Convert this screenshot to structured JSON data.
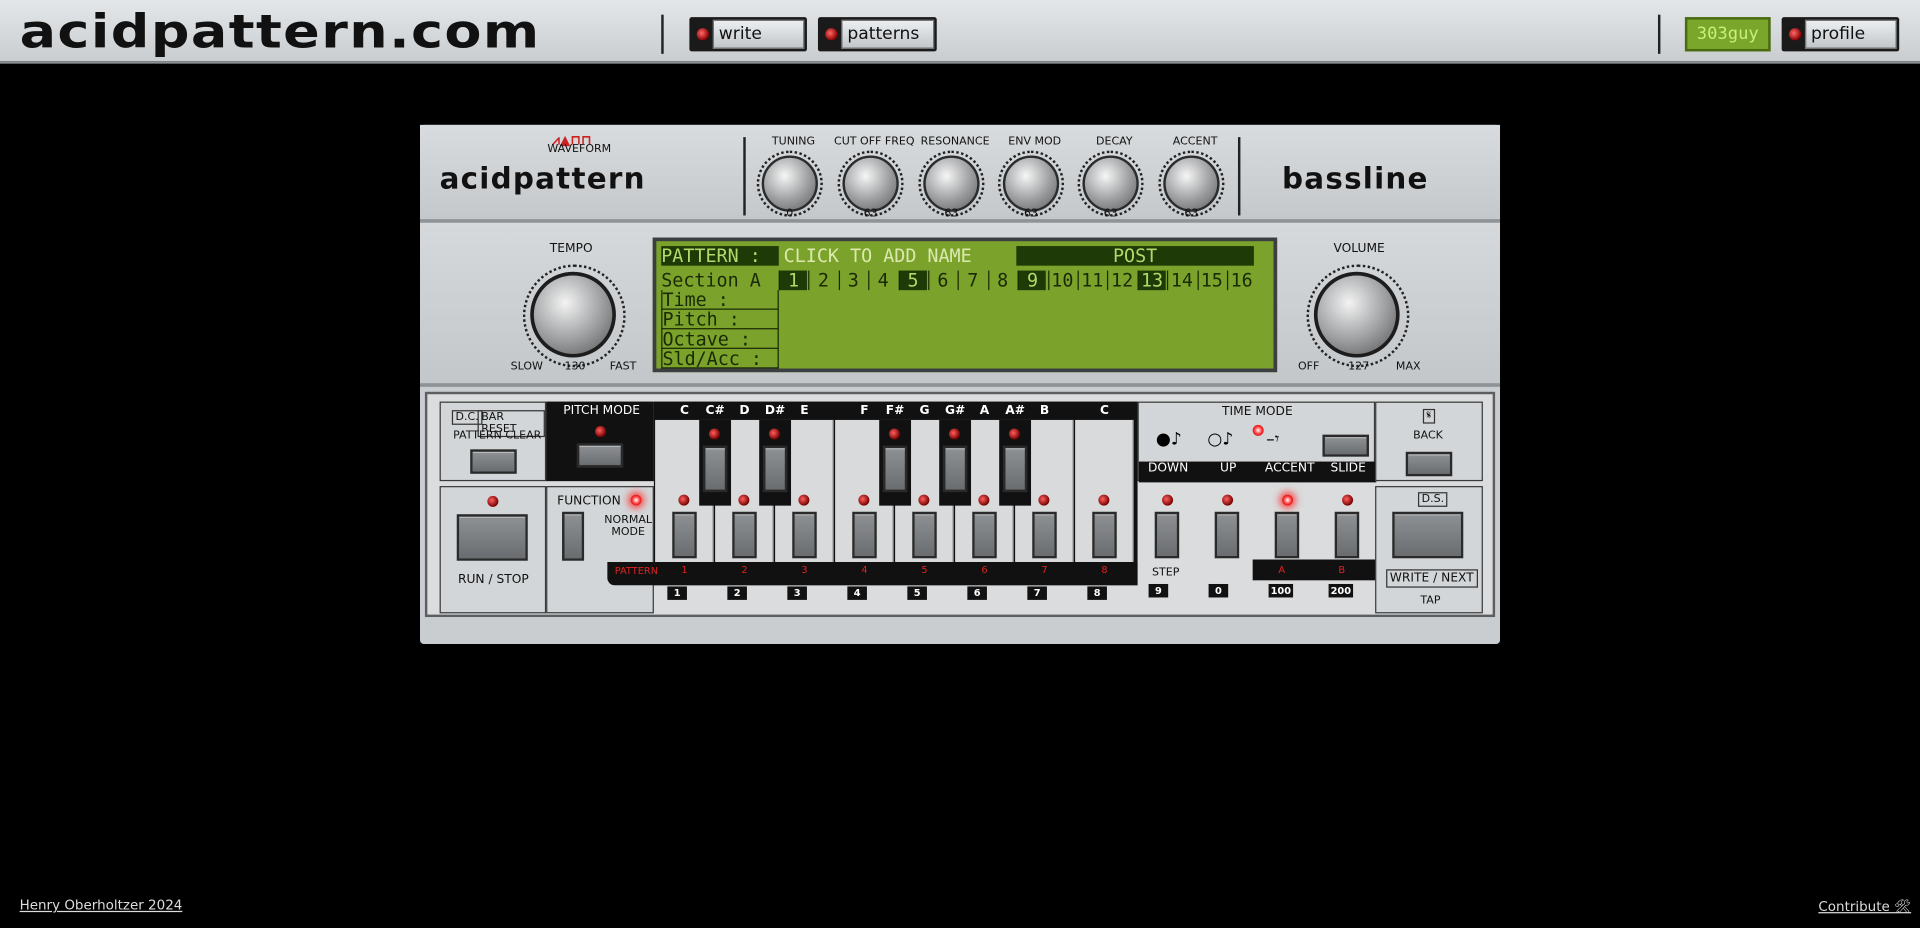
{
  "header": {
    "logo": "acidpattern.com",
    "nav": [
      {
        "label": "write"
      },
      {
        "label": "patterns"
      }
    ],
    "user": "303guy",
    "profile": "profile"
  },
  "synth": {
    "brand": "acidpattern",
    "model": "bassline",
    "waveform_label": "WAVEFORM",
    "knobs": [
      {
        "label": "TUNING",
        "value": "0"
      },
      {
        "label": "CUT OFF FREQ",
        "value": "63"
      },
      {
        "label": "RESONANCE",
        "value": "63"
      },
      {
        "label": "ENV MOD",
        "value": "63"
      },
      {
        "label": "DECAY",
        "value": "63"
      },
      {
        "label": "ACCENT",
        "value": "63"
      }
    ],
    "tempo": {
      "label": "TEMPO",
      "min": "SLOW",
      "value": "130",
      "max": "FAST"
    },
    "volume": {
      "label": "VOLUME",
      "min": "OFF",
      "value": "127",
      "max": "MAX"
    }
  },
  "lcd": {
    "pattern_label": "PATTERN :",
    "name_prompt": "CLICK TO ADD NAME",
    "post": "POST",
    "section_label": "Section A",
    "steps": [
      "1",
      "2",
      "3",
      "4",
      "5",
      "6",
      "7",
      "8",
      "9",
      "10",
      "11",
      "12",
      "13",
      "14",
      "15",
      "16"
    ],
    "rows": [
      "Time      :",
      "Pitch     :",
      "Octave    :",
      "Sld/Acc   :"
    ]
  },
  "controls": {
    "dc": "D.C.",
    "bar_reset": "BAR RESET",
    "pattern_clear": "PATTERN CLEAR",
    "pitch_mode": "PITCH MODE",
    "function": "FUNCTION",
    "normal_mode": "NORMAL MODE",
    "run_stop": "RUN / STOP",
    "pattern": "PATTERN",
    "time_mode": "TIME MODE",
    "back": "BACK",
    "ds": "D.S.",
    "write_next": "WRITE / NEXT",
    "tap": "TAP",
    "step": "STEP",
    "notes": [
      "C",
      "C#",
      "D",
      "D#",
      "E",
      "F",
      "F#",
      "G",
      "G#",
      "A",
      "A#",
      "B",
      "C"
    ],
    "pattern_numbers": [
      "1",
      "2",
      "3",
      "4",
      "5",
      "6",
      "7",
      "8"
    ],
    "bottom_numbers": [
      "1",
      "2",
      "3",
      "4",
      "5",
      "6",
      "7",
      "8",
      "9",
      "0",
      "100",
      "200"
    ],
    "mode_labels": [
      "DOWN",
      "UP",
      "ACCENT",
      "SLIDE"
    ],
    "ab": [
      "A",
      "B"
    ]
  },
  "footer": {
    "credit": "Henry Oberholtzer 2024",
    "contribute": "Contribute 🛠"
  }
}
